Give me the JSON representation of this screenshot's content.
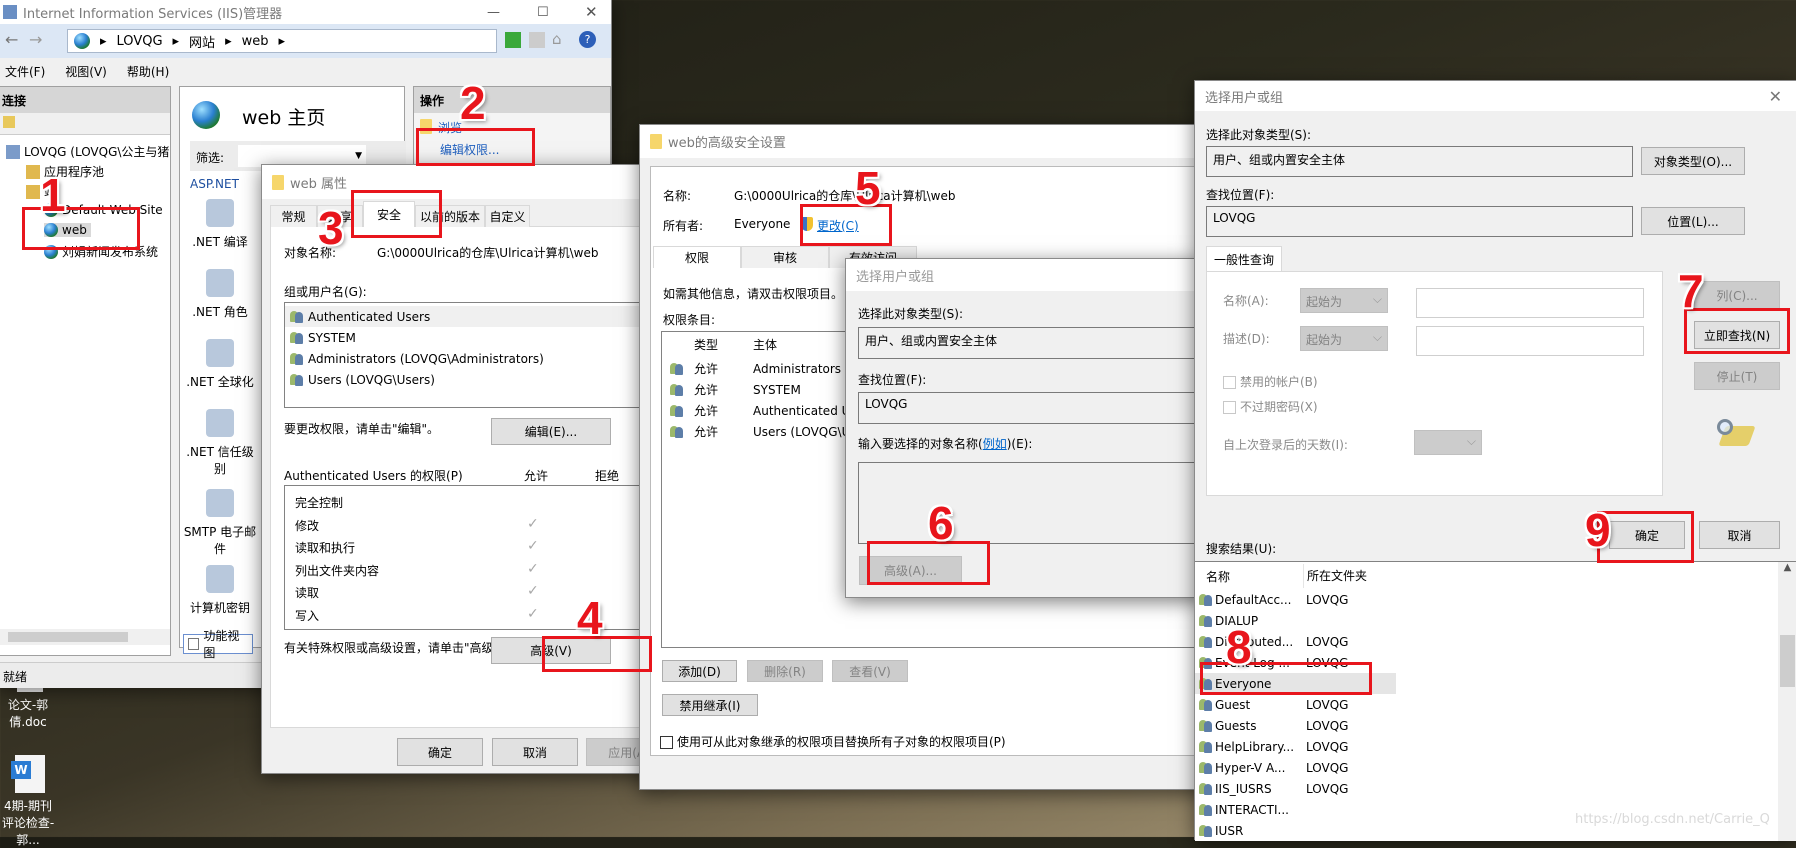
{
  "iis": {
    "title": "Internet Information Services (IIS)管理器",
    "breadcrumb": [
      "LOVQG",
      "网站",
      "web"
    ],
    "menu": [
      "文件(F)",
      "视图(V)",
      "帮助(H)"
    ],
    "connections_header": "连接",
    "tree": [
      {
        "label": "LOVQG (LOVQG\\公主与猪",
        "icon": "server-icon"
      },
      {
        "label": "应用程序池",
        "icon": "app-pool-icon"
      },
      {
        "label": "站",
        "icon": "sites-folder-icon"
      },
      {
        "label": "Default Web Site",
        "icon": "globe-icon"
      },
      {
        "label": "web",
        "icon": "globe-icon",
        "selected": true
      },
      {
        "label": "刘娟新闻发布系统",
        "icon": "globe-icon"
      }
    ],
    "home_title": "web 主页",
    "filter_label": "筛选:",
    "group_label": "ASP.NET",
    "features": [
      ".NET 编译",
      ".NET 角色",
      ".NET 全球化",
      ".NET 信任级别",
      "SMTP 电子邮件",
      "计算机密钥"
    ],
    "view_tab": "功能视图",
    "actions_header": "操作",
    "actions": [
      "浏览",
      "编辑权限..."
    ],
    "status": "就绪"
  },
  "desktop_icons": [
    "论文-郭倩.doc",
    "4期-期刊评论检查-郭..."
  ],
  "props": {
    "title": "web 属性",
    "tabs": [
      "常规",
      "共享",
      "安全",
      "以前的版本",
      "自定义"
    ],
    "selected_tab": "安全",
    "object_label": "对象名称:",
    "object_value": "G:\\0000Ulrica的仓库\\Ulrica计算机\\web",
    "group_label": "组或用户名(G):",
    "users": [
      "Authenticated Users",
      "SYSTEM",
      "Administrators (LOVQG\\Administrators)",
      "Users (LOVQG\\Users)"
    ],
    "change_hint": "要更改权限，请单击\"编辑\"。",
    "edit_btn": "编辑(E)...",
    "perm_header": "Authenticated Users 的权限(P)",
    "allow": "允许",
    "deny": "拒绝",
    "perms": [
      {
        "name": "完全控制",
        "allow": false
      },
      {
        "name": "修改",
        "allow": true
      },
      {
        "name": "读取和执行",
        "allow": true
      },
      {
        "name": "列出文件夹内容",
        "allow": true
      },
      {
        "name": "读取",
        "allow": true
      },
      {
        "name": "写入",
        "allow": true
      }
    ],
    "adv_hint": "有关特殊权限或高级设置，请单击\"高级\"。",
    "adv_btn": "高级(V)",
    "ok": "确定",
    "cancel": "取消",
    "apply": "应用(A)"
  },
  "advanced": {
    "title": "web的高级安全设置",
    "name_label": "名称:",
    "name_value": "G:\\0000Ulrica的仓库\\Ulrica计算机\\web",
    "owner_label": "所有者:",
    "owner_value": "Everyone",
    "change_link": "更改(C)",
    "tabs": [
      "权限",
      "审核",
      "有效访问"
    ],
    "info": "如需其他信息，请双击权限项目。",
    "entries_label": "权限条目:",
    "columns": [
      "类型",
      "主体"
    ],
    "entries": [
      {
        "type": "允许",
        "principal": "Administrators (LOVQG\\Administrators)"
      },
      {
        "type": "允许",
        "principal": "SYSTEM"
      },
      {
        "type": "允许",
        "principal": "Authenticated Users"
      },
      {
        "type": "允许",
        "principal": "Users (LOVQG\\Users)"
      }
    ],
    "add": "添加(D)",
    "remove": "删除(R)",
    "view": "查看(V)",
    "disable_inherit": "禁用继承(I)",
    "replace_label": "使用可从此对象继承的权限项目替换所有子对象的权限项目(P)"
  },
  "select_small": {
    "title": "选择用户或组",
    "type_label": "选择此对象类型(S):",
    "type_value": "用户、组或内置安全主体",
    "loc_label": "查找位置(F):",
    "loc_value": "LOVQG",
    "enter_label_pre": "输入要选择的对象名称(",
    "enter_link": "例如",
    "enter_label_post": ")(E):",
    "adv_btn": "高级(A)..."
  },
  "select_big": {
    "title": "选择用户或组",
    "type_label": "选择此对象类型(S):",
    "type_value": "用户、组或内置安全主体",
    "type_btn": "对象类型(O)...",
    "loc_label": "查找位置(F):",
    "loc_value": "LOVQG",
    "loc_btn": "位置(L)...",
    "query_tab": "一般性查询",
    "name_label": "名称(A):",
    "desc_label": "描述(D):",
    "starts_with": "起始为",
    "disabled_accounts": "禁用的帐户(B)",
    "no_expire": "不过期密码(X)",
    "days_label": "自上次登录后的天数(I):",
    "columns_btn": "列(C)...",
    "find_btn": "立即查找(N)",
    "stop_btn": "停止(T)",
    "ok": "确定",
    "cancel": "取消",
    "results_label": "搜索结果(U):",
    "result_cols": [
      "名称",
      "所在文件夹"
    ],
    "results": [
      {
        "name": "DefaultAcc...",
        "folder": "LOVQG"
      },
      {
        "name": "DIALUP",
        "folder": ""
      },
      {
        "name": "Distributed...",
        "folder": "LOVQG"
      },
      {
        "name": "Event Log ...",
        "folder": "LOVQG"
      },
      {
        "name": "Everyone",
        "folder": "",
        "selected": true
      },
      {
        "name": "Guest",
        "folder": "LOVQG"
      },
      {
        "name": "Guests",
        "folder": "LOVQG"
      },
      {
        "name": "HelpLibrary...",
        "folder": "LOVQG"
      },
      {
        "name": "Hyper-V A...",
        "folder": "LOVQG"
      },
      {
        "name": "IIS_IUSRS",
        "folder": "LOVQG"
      },
      {
        "name": "INTERACTI...",
        "folder": ""
      },
      {
        "name": "IUSR",
        "folder": ""
      }
    ]
  },
  "annotations": [
    "1",
    "2",
    "3",
    "4",
    "5",
    "6",
    "7",
    "8",
    "9"
  ],
  "watermark": "https://blog.csdn.net/Carrie_Q",
  "colors": {
    "annotation": "#e8151c",
    "link": "#0066cc",
    "selection": "#cce8ff"
  }
}
